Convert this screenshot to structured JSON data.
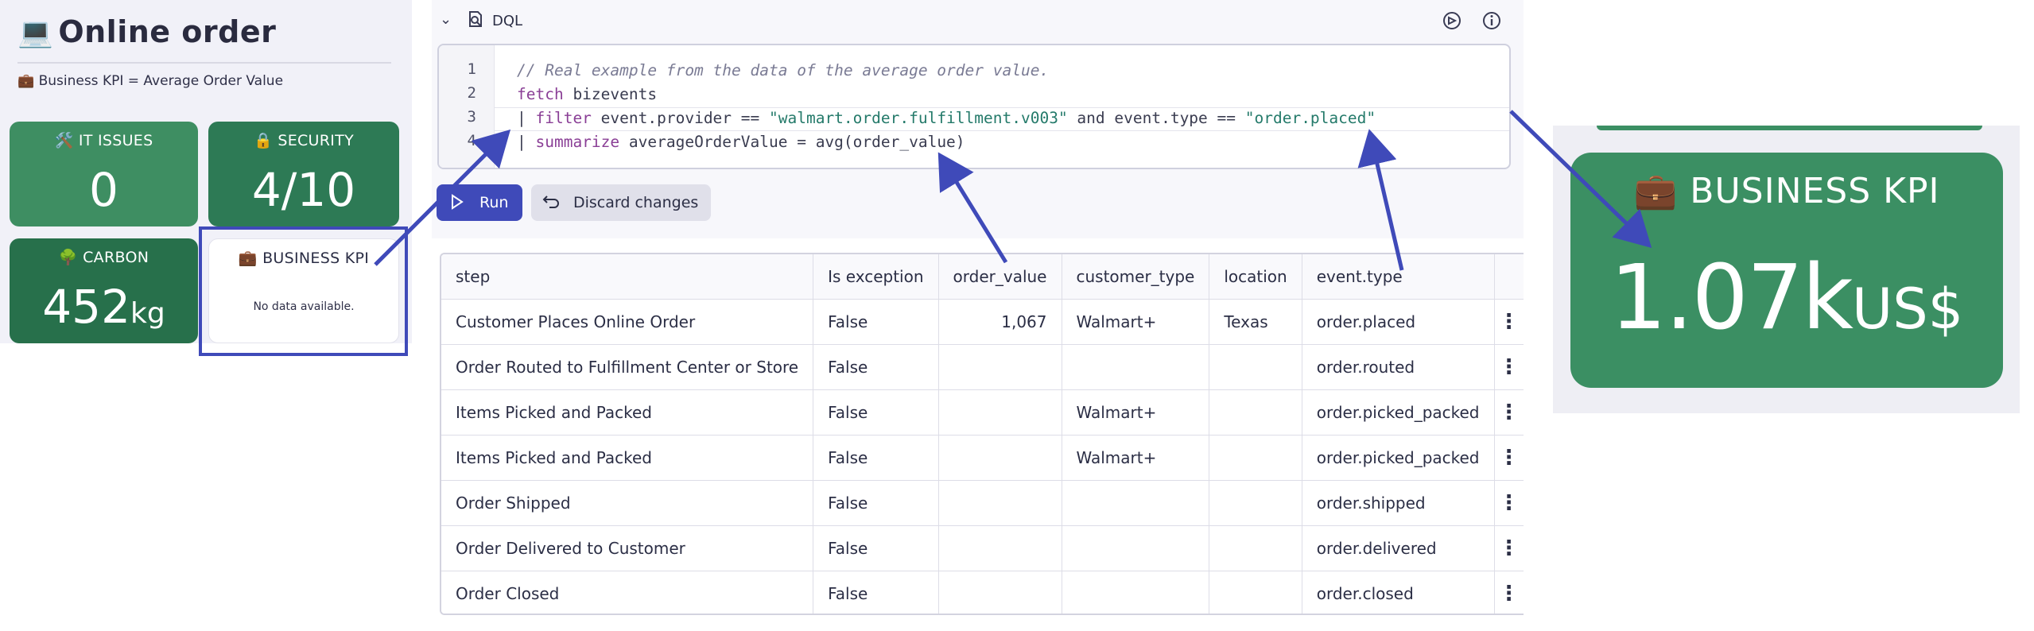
{
  "dashboard": {
    "title_icon": "💻",
    "title": "Online order",
    "subtitle_icon": "💼",
    "subtitle": "Business KPI = Average Order Value",
    "tiles": {
      "it_issues": {
        "icon": "🛠️",
        "label": "IT ISSUES",
        "value": "0"
      },
      "security": {
        "icon": "🔒",
        "label": "SECURITY",
        "value": "4/10"
      },
      "carbon": {
        "icon": "🌳",
        "label": "CARBON",
        "value": "452",
        "unit": "kg"
      },
      "business_kpi": {
        "icon": "💼",
        "label": "BUSINESS KPI",
        "message": "No data available."
      }
    },
    "colors": {
      "tile_green_light": "#3e8e62",
      "tile_green": "#2d7a55",
      "tile_green_dark": "#27704b",
      "highlight": "#3f4ab9"
    }
  },
  "dql": {
    "section_title": "DQL",
    "line_numbers": [
      "1",
      "2",
      "3",
      "4"
    ],
    "lines": {
      "l1_comment": "// Real example from the data of the average order value.",
      "l2_kw": "fetch",
      "l2_rest": " bizevents",
      "l3_pipe": "| ",
      "l3_kw": "filter",
      "l3_a": " event.provider == ",
      "l3_str1": "\"walmart.order.fulfillment.v003\"",
      "l3_b": " and event.type == ",
      "l3_str2": "\"order.placed\"",
      "l4_pipe": "| ",
      "l4_kw": "summarize",
      "l4_rest": " averageOrderValue = avg(order_value)"
    },
    "run_label": "Run",
    "discard_label": "Discard changes"
  },
  "table": {
    "columns": [
      "step",
      "Is exception",
      "order_value",
      "customer_type",
      "location",
      "event.type"
    ],
    "rows": [
      [
        "Customer Places Online Order",
        "False",
        "1,067",
        "Walmart+",
        "Texas",
        "order.placed"
      ],
      [
        "Order Routed to Fulfillment Center or Store",
        "False",
        "",
        "",
        "",
        "order.routed"
      ],
      [
        "Items Picked and Packed",
        "False",
        "",
        "Walmart+",
        "",
        "order.picked_packed"
      ],
      [
        "Items Picked and Packed",
        "False",
        "",
        "Walmart+",
        "",
        "order.picked_packed"
      ],
      [
        "Order Shipped",
        "False",
        "",
        "",
        "",
        "order.shipped"
      ],
      [
        "Order Delivered to Customer",
        "False",
        "",
        "",
        "",
        "order.delivered"
      ],
      [
        "Order Closed",
        "False",
        "",
        "",
        "",
        "order.closed"
      ]
    ]
  },
  "zoom_kpi": {
    "icon": "💼",
    "label": "BUSINESS KPI",
    "value": "1.07k",
    "unit": "US$",
    "color": "#3b8f63"
  },
  "arrow_color": "#3f4ab9"
}
